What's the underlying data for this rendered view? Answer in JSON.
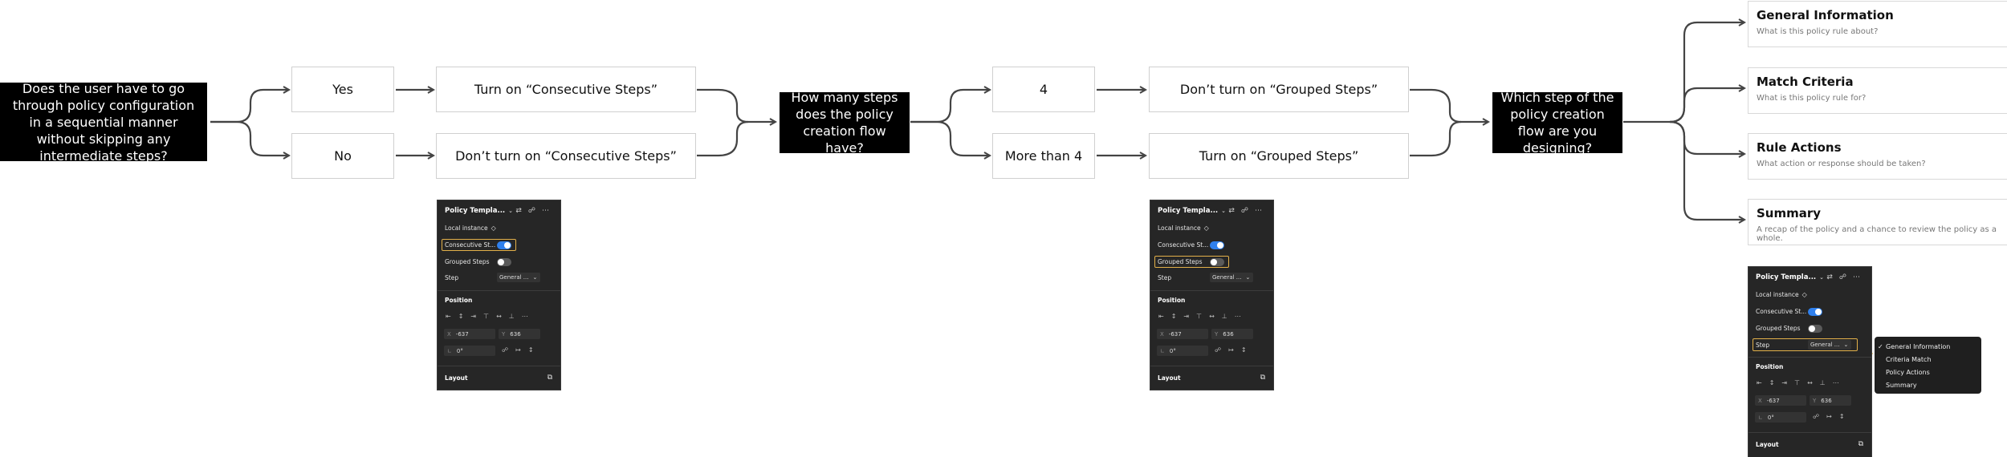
{
  "diagram": {
    "q1": "Does the user have to go through policy configuration in a sequential manner without skipping any intermediate steps?",
    "a_yes": "Yes",
    "a_no": "No",
    "r_turn_on_consecutive": "Turn on “Consecutive Steps”",
    "r_dont_consecutive": "Don’t turn on “Consecutive Steps”",
    "q2": "How many steps does the policy creation flow have?",
    "a_four": "4",
    "a_more": "More than 4",
    "r_dont_grouped": "Don’t turn on “Grouped Steps”",
    "r_turn_on_grouped": "Turn on “Grouped Steps”",
    "q3": "Which step of the policy creation flow are you designing?",
    "cards": [
      {
        "title": "General Information",
        "subtitle": "What is this policy rule about?"
      },
      {
        "title": "Match Criteria",
        "subtitle": "What is this policy rule for?"
      },
      {
        "title": "Rule Actions",
        "subtitle": "What action or response should be taken?"
      },
      {
        "title": "Summary",
        "subtitle": "A recap of the policy and a chance to review the policy as a whole."
      }
    ]
  },
  "panel": {
    "title": "Policy Templa...",
    "local_instance": "Local instance",
    "consecutive": "Consecutive St...",
    "grouped": "Grouped Steps",
    "step": "Step",
    "step_value": "General ...",
    "position": "Position",
    "x_label": "X",
    "x_value": "-637",
    "y_label": "Y",
    "y_value": "636",
    "angle_label": "∟",
    "angle_value": "0°",
    "layout": "Layout"
  },
  "dropdown": {
    "options": [
      "General Information",
      "Criteria Match",
      "Policy Actions",
      "Summary"
    ]
  },
  "colors": {
    "toggle_on": "#2f80ed",
    "highlight": "#e2b04a",
    "panel_bg": "#262626"
  }
}
